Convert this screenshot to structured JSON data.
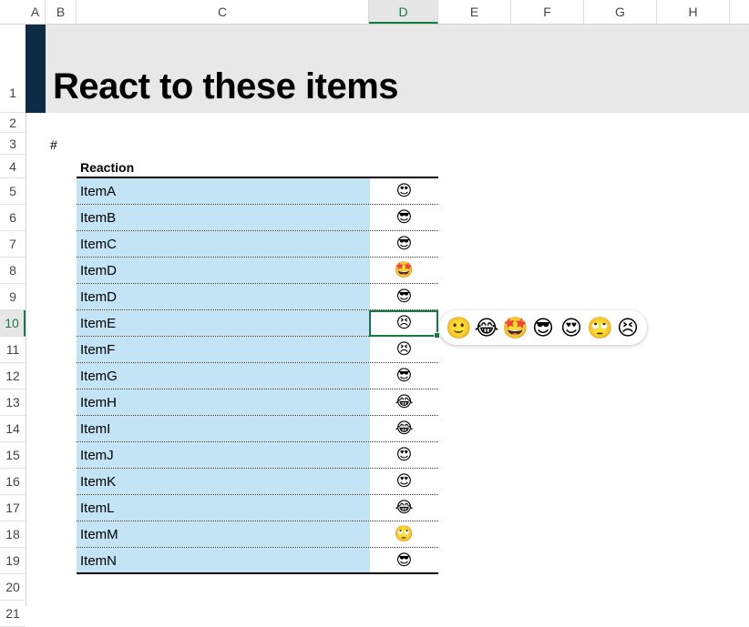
{
  "columns": [
    "A",
    "B",
    "C",
    "D",
    "E",
    "F",
    "G",
    "H"
  ],
  "rows": [
    "1",
    "2",
    "3",
    "4",
    "5",
    "6",
    "7",
    "8",
    "9",
    "10",
    "11",
    "12",
    "13",
    "14",
    "15",
    "16",
    "17",
    "18",
    "19",
    "20",
    "21"
  ],
  "selected": {
    "column": "D",
    "row": "10"
  },
  "title": "React to these items",
  "hash": "#",
  "table": {
    "header": "Reaction",
    "items": [
      {
        "name": "ItemA",
        "reaction": "😍"
      },
      {
        "name": "ItemB",
        "reaction": "😎"
      },
      {
        "name": "ItemC",
        "reaction": "😎"
      },
      {
        "name": "ItemD",
        "reaction": "🤩"
      },
      {
        "name": "ItemD",
        "reaction": "😎"
      },
      {
        "name": "ItemE",
        "reaction": "😣"
      },
      {
        "name": "ItemF",
        "reaction": "😣"
      },
      {
        "name": "ItemG",
        "reaction": "😎"
      },
      {
        "name": "ItemH",
        "reaction": "😂"
      },
      {
        "name": "ItemI",
        "reaction": "😂"
      },
      {
        "name": "ItemJ",
        "reaction": "😍"
      },
      {
        "name": "ItemK",
        "reaction": "😍"
      },
      {
        "name": "ItemL",
        "reaction": "😂"
      },
      {
        "name": "ItemM",
        "reaction": "🙄"
      },
      {
        "name": "ItemN",
        "reaction": "😎"
      }
    ]
  },
  "picker": {
    "options": [
      "🙂",
      "😂",
      "🤩",
      "😎",
      "😍",
      "🙄",
      "😣"
    ]
  },
  "colors": {
    "banner_band": "#0d2b45",
    "banner": "#e8e8e8",
    "item_fill": "#c2e4f5",
    "selection": "#107c41"
  }
}
